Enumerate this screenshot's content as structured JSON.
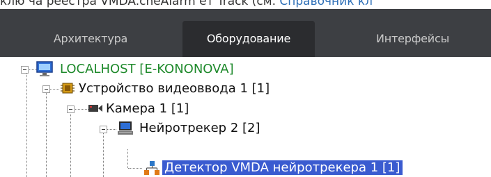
{
  "doc": {
    "prefix": "клю ча реестра VMDA.chеAlarm ет Track (см. ",
    "link": "Справочник кл"
  },
  "tabs": [
    {
      "label": "Архитектура",
      "active": false
    },
    {
      "label": "Оборудование",
      "active": true
    },
    {
      "label": "Интерфейсы",
      "active": false
    }
  ],
  "tree": {
    "root": {
      "label": "LOCALHOST [E-KONONOVA]",
      "icon": "monitor-icon"
    },
    "video_device": {
      "label": "Устройство видеоввода 1 [1]",
      "icon": "chip-icon"
    },
    "camera": {
      "label": "Камера 1 [1]",
      "icon": "camera-icon"
    },
    "neurotracker": {
      "label": "Нейротрекер 2 [2]",
      "icon": "computer-icon"
    },
    "detector": {
      "label": "Детектор VMDA нейротрекера 1 [1]",
      "icon": "detector-icon",
      "selected": true
    }
  },
  "colors": {
    "tab_bar": "#3d3f43",
    "tab_active": "#2b2c2f",
    "selection": "#3a5bd0",
    "root_text": "#1f8a2c",
    "link": "#2e6fb7"
  }
}
